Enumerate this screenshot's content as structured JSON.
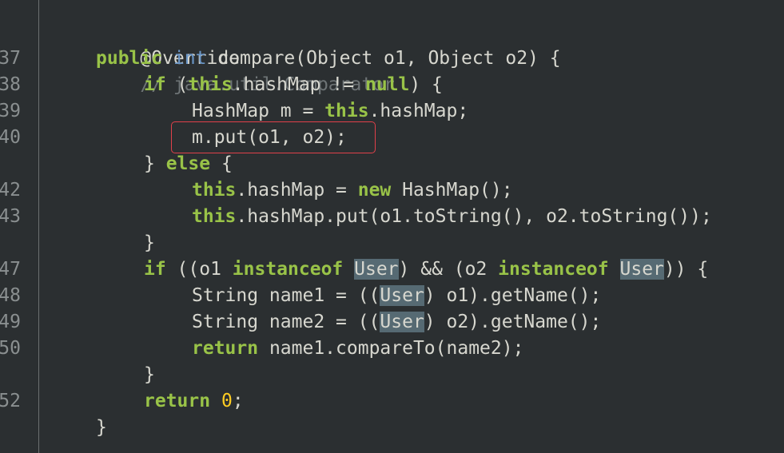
{
  "gutter": {
    "line_numbers": [
      "37",
      "38",
      "39",
      "40",
      "",
      "42",
      "43",
      "",
      "47",
      "48",
      "49",
      "50",
      "",
      "52",
      ""
    ]
  },
  "code": {
    "annotation": "@Override",
    "annotation_comment": "// java.util.Comparator",
    "lines": [
      [
        {
          "t": "public",
          "c": "kw"
        },
        {
          "t": " ",
          "c": "plain"
        },
        {
          "t": "int",
          "c": "type"
        },
        {
          "t": " compare(Object o1, Object o2) {",
          "c": "plain"
        }
      ],
      [
        {
          "t": "if",
          "c": "kw"
        },
        {
          "t": " (",
          "c": "plain"
        },
        {
          "t": "this",
          "c": "kw"
        },
        {
          "t": ".hashMap != ",
          "c": "plain"
        },
        {
          "t": "null",
          "c": "kw"
        },
        {
          "t": ") {",
          "c": "plain"
        }
      ],
      [
        {
          "t": "HashMap m = ",
          "c": "plain"
        },
        {
          "t": "this",
          "c": "kw"
        },
        {
          "t": ".hashMap;",
          "c": "plain"
        }
      ],
      [
        {
          "t": "m.put(o1, o2);",
          "c": "plain"
        }
      ],
      [
        {
          "t": "} ",
          "c": "plain"
        },
        {
          "t": "else",
          "c": "kw"
        },
        {
          "t": " {",
          "c": "plain"
        }
      ],
      [
        {
          "t": "this",
          "c": "kw"
        },
        {
          "t": ".hashMap = ",
          "c": "plain"
        },
        {
          "t": "new",
          "c": "kw"
        },
        {
          "t": " HashMap();",
          "c": "plain"
        }
      ],
      [
        {
          "t": "this",
          "c": "kw"
        },
        {
          "t": ".hashMap.put(o1.toString(), o2.toString());",
          "c": "plain"
        }
      ],
      [
        {
          "t": "}",
          "c": "plain"
        }
      ],
      [
        {
          "t": "if",
          "c": "kw"
        },
        {
          "t": " ((o1 ",
          "c": "plain"
        },
        {
          "t": "instanceof",
          "c": "kw"
        },
        {
          "t": " ",
          "c": "plain"
        },
        {
          "t": "User",
          "c": "hl"
        },
        {
          "t": ") && (o2 ",
          "c": "plain"
        },
        {
          "t": "instanceof",
          "c": "kw"
        },
        {
          "t": " ",
          "c": "plain"
        },
        {
          "t": "User",
          "c": "hl"
        },
        {
          "t": ")) {",
          "c": "plain"
        }
      ],
      [
        {
          "t": "String name1 = ((",
          "c": "plain"
        },
        {
          "t": "User",
          "c": "hl"
        },
        {
          "t": ") o1).getName();",
          "c": "plain"
        }
      ],
      [
        {
          "t": "String name2 = ((",
          "c": "plain"
        },
        {
          "t": "User",
          "c": "hl"
        },
        {
          "t": ") o2).getName();",
          "c": "plain"
        }
      ],
      [
        {
          "t": "return",
          "c": "kw"
        },
        {
          "t": " name1.compareTo(name2);",
          "c": "plain"
        }
      ],
      [
        {
          "t": "}",
          "c": "plain"
        }
      ],
      [
        {
          "t": "return",
          "c": "kw"
        },
        {
          "t": " ",
          "c": "plain"
        },
        {
          "t": "0",
          "c": "num"
        },
        {
          "t": ";",
          "c": "plain"
        }
      ],
      [
        {
          "t": "}",
          "c": "plain"
        }
      ]
    ]
  },
  "highlight_box_line": "m.put(o1, o2);",
  "colors": {
    "background": "#2b2f31",
    "keyword": "#99c348",
    "type": "#6b97c8",
    "comment": "#6e7476",
    "number": "#ffcd22",
    "selection": "#566a73",
    "box_border": "#e0404a"
  }
}
